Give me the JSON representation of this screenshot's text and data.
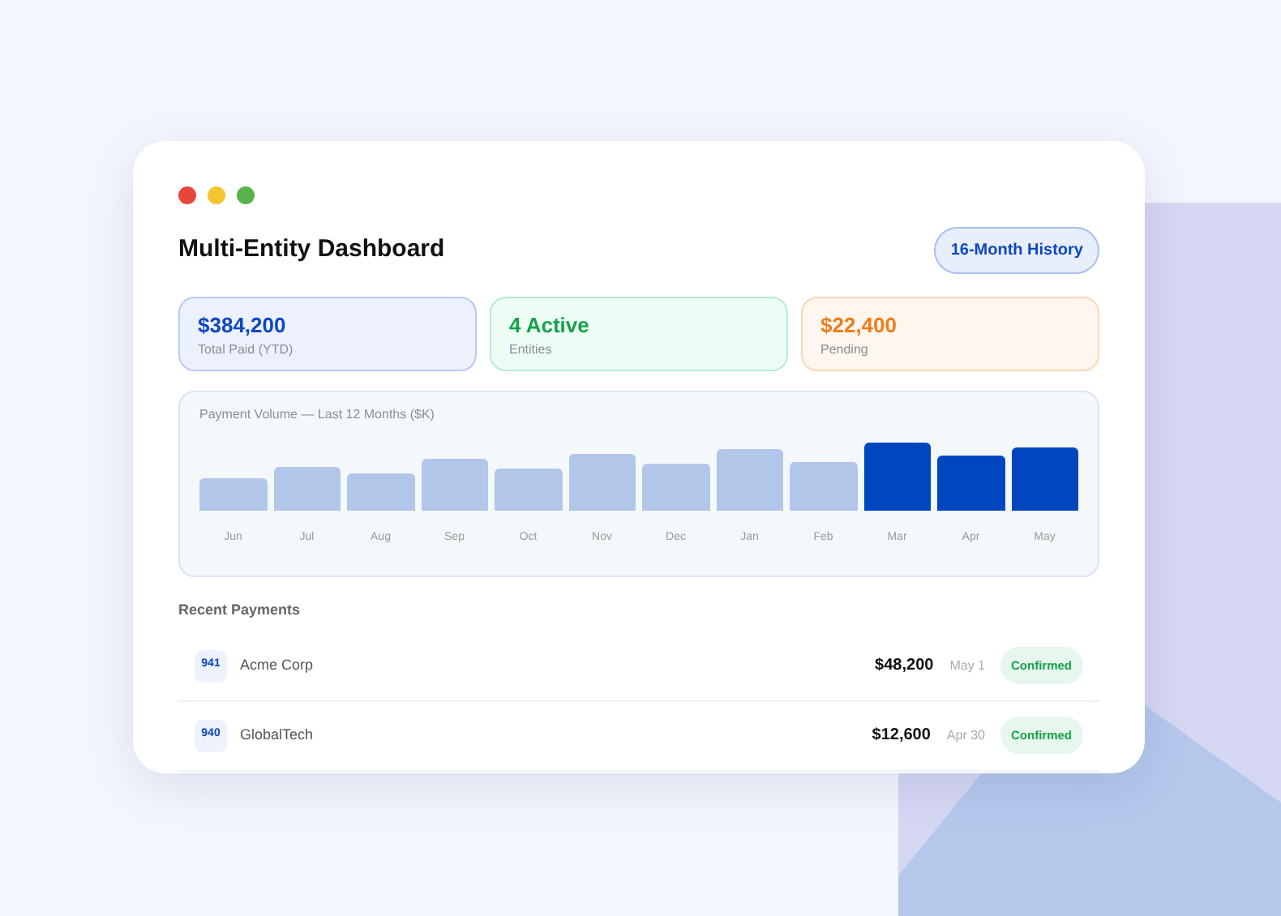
{
  "window": {
    "controls": [
      {
        "color": "#e8453c"
      },
      {
        "color": "#f5c431"
      },
      {
        "color": "#5ab34a"
      }
    ]
  },
  "header": {
    "title": "Multi-Entity Dashboard",
    "badge": "16-Month History"
  },
  "stats": [
    {
      "kind": "blue",
      "value": "$384,200",
      "label": "Total Paid (YTD)"
    },
    {
      "kind": "green",
      "value": "4 Active",
      "label": "Entities"
    },
    {
      "kind": "orange",
      "value": "$22,400",
      "label": "Pending"
    }
  ],
  "volume": {
    "title": "Payment Volume — Last 12 Months ($K)",
    "months": [
      {
        "label": "Jun",
        "highlighted": false
      },
      {
        "label": "Jul",
        "highlighted": false
      },
      {
        "label": "Aug",
        "highlighted": false
      },
      {
        "label": "Sep",
        "highlighted": false
      },
      {
        "label": "Oct",
        "highlighted": false
      },
      {
        "label": "Nov",
        "highlighted": false
      },
      {
        "label": "Dec",
        "highlighted": false
      },
      {
        "label": "Jan",
        "highlighted": false
      },
      {
        "label": "Feb",
        "highlighted": false
      },
      {
        "label": "Mar",
        "highlighted": true
      },
      {
        "label": "Apr",
        "highlighted": true
      },
      {
        "label": "May",
        "highlighted": true
      }
    ]
  },
  "recent": {
    "title": "Recent Payments",
    "rows": [
      {
        "code": "941",
        "name": "Acme Corp",
        "amount": "$48,200",
        "date": "May 1",
        "status": "Confirmed"
      },
      {
        "code": "940",
        "name": "GlobalTech",
        "amount": "$12,600",
        "date": "Apr 30",
        "status": "Confirmed"
      }
    ]
  }
}
